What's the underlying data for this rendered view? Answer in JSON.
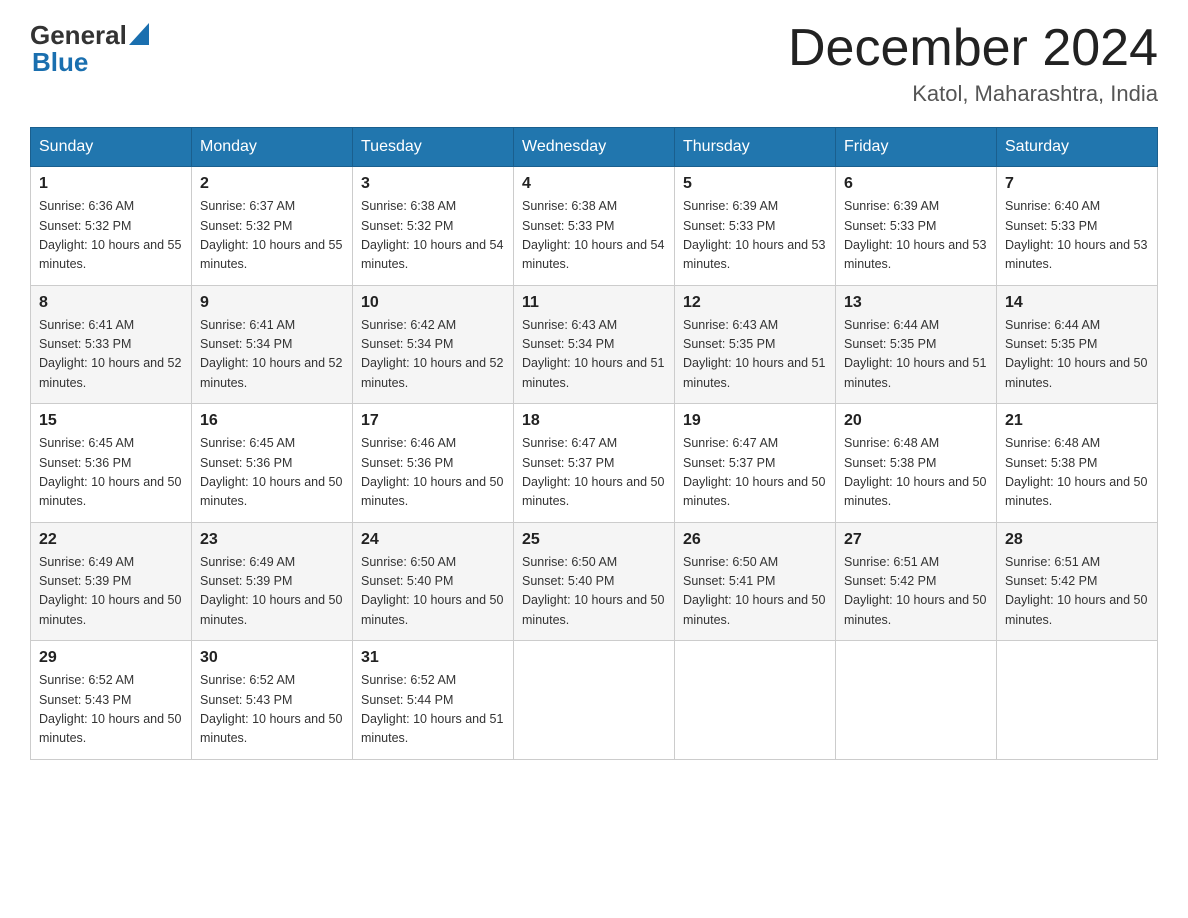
{
  "header": {
    "logo": {
      "general": "General",
      "blue": "Blue"
    },
    "month": "December 2024",
    "location": "Katol, Maharashtra, India"
  },
  "weekdays": [
    "Sunday",
    "Monday",
    "Tuesday",
    "Wednesday",
    "Thursday",
    "Friday",
    "Saturday"
  ],
  "weeks": [
    [
      {
        "day": "1",
        "sunrise": "6:36 AM",
        "sunset": "5:32 PM",
        "daylight": "10 hours and 55 minutes."
      },
      {
        "day": "2",
        "sunrise": "6:37 AM",
        "sunset": "5:32 PM",
        "daylight": "10 hours and 55 minutes."
      },
      {
        "day": "3",
        "sunrise": "6:38 AM",
        "sunset": "5:32 PM",
        "daylight": "10 hours and 54 minutes."
      },
      {
        "day": "4",
        "sunrise": "6:38 AM",
        "sunset": "5:33 PM",
        "daylight": "10 hours and 54 minutes."
      },
      {
        "day": "5",
        "sunrise": "6:39 AM",
        "sunset": "5:33 PM",
        "daylight": "10 hours and 53 minutes."
      },
      {
        "day": "6",
        "sunrise": "6:39 AM",
        "sunset": "5:33 PM",
        "daylight": "10 hours and 53 minutes."
      },
      {
        "day": "7",
        "sunrise": "6:40 AM",
        "sunset": "5:33 PM",
        "daylight": "10 hours and 53 minutes."
      }
    ],
    [
      {
        "day": "8",
        "sunrise": "6:41 AM",
        "sunset": "5:33 PM",
        "daylight": "10 hours and 52 minutes."
      },
      {
        "day": "9",
        "sunrise": "6:41 AM",
        "sunset": "5:34 PM",
        "daylight": "10 hours and 52 minutes."
      },
      {
        "day": "10",
        "sunrise": "6:42 AM",
        "sunset": "5:34 PM",
        "daylight": "10 hours and 52 minutes."
      },
      {
        "day": "11",
        "sunrise": "6:43 AM",
        "sunset": "5:34 PM",
        "daylight": "10 hours and 51 minutes."
      },
      {
        "day": "12",
        "sunrise": "6:43 AM",
        "sunset": "5:35 PM",
        "daylight": "10 hours and 51 minutes."
      },
      {
        "day": "13",
        "sunrise": "6:44 AM",
        "sunset": "5:35 PM",
        "daylight": "10 hours and 51 minutes."
      },
      {
        "day": "14",
        "sunrise": "6:44 AM",
        "sunset": "5:35 PM",
        "daylight": "10 hours and 50 minutes."
      }
    ],
    [
      {
        "day": "15",
        "sunrise": "6:45 AM",
        "sunset": "5:36 PM",
        "daylight": "10 hours and 50 minutes."
      },
      {
        "day": "16",
        "sunrise": "6:45 AM",
        "sunset": "5:36 PM",
        "daylight": "10 hours and 50 minutes."
      },
      {
        "day": "17",
        "sunrise": "6:46 AM",
        "sunset": "5:36 PM",
        "daylight": "10 hours and 50 minutes."
      },
      {
        "day": "18",
        "sunrise": "6:47 AM",
        "sunset": "5:37 PM",
        "daylight": "10 hours and 50 minutes."
      },
      {
        "day": "19",
        "sunrise": "6:47 AM",
        "sunset": "5:37 PM",
        "daylight": "10 hours and 50 minutes."
      },
      {
        "day": "20",
        "sunrise": "6:48 AM",
        "sunset": "5:38 PM",
        "daylight": "10 hours and 50 minutes."
      },
      {
        "day": "21",
        "sunrise": "6:48 AM",
        "sunset": "5:38 PM",
        "daylight": "10 hours and 50 minutes."
      }
    ],
    [
      {
        "day": "22",
        "sunrise": "6:49 AM",
        "sunset": "5:39 PM",
        "daylight": "10 hours and 50 minutes."
      },
      {
        "day": "23",
        "sunrise": "6:49 AM",
        "sunset": "5:39 PM",
        "daylight": "10 hours and 50 minutes."
      },
      {
        "day": "24",
        "sunrise": "6:50 AM",
        "sunset": "5:40 PM",
        "daylight": "10 hours and 50 minutes."
      },
      {
        "day": "25",
        "sunrise": "6:50 AM",
        "sunset": "5:40 PM",
        "daylight": "10 hours and 50 minutes."
      },
      {
        "day": "26",
        "sunrise": "6:50 AM",
        "sunset": "5:41 PM",
        "daylight": "10 hours and 50 minutes."
      },
      {
        "day": "27",
        "sunrise": "6:51 AM",
        "sunset": "5:42 PM",
        "daylight": "10 hours and 50 minutes."
      },
      {
        "day": "28",
        "sunrise": "6:51 AM",
        "sunset": "5:42 PM",
        "daylight": "10 hours and 50 minutes."
      }
    ],
    [
      {
        "day": "29",
        "sunrise": "6:52 AM",
        "sunset": "5:43 PM",
        "daylight": "10 hours and 50 minutes."
      },
      {
        "day": "30",
        "sunrise": "6:52 AM",
        "sunset": "5:43 PM",
        "daylight": "10 hours and 50 minutes."
      },
      {
        "day": "31",
        "sunrise": "6:52 AM",
        "sunset": "5:44 PM",
        "daylight": "10 hours and 51 minutes."
      },
      null,
      null,
      null,
      null
    ]
  ]
}
